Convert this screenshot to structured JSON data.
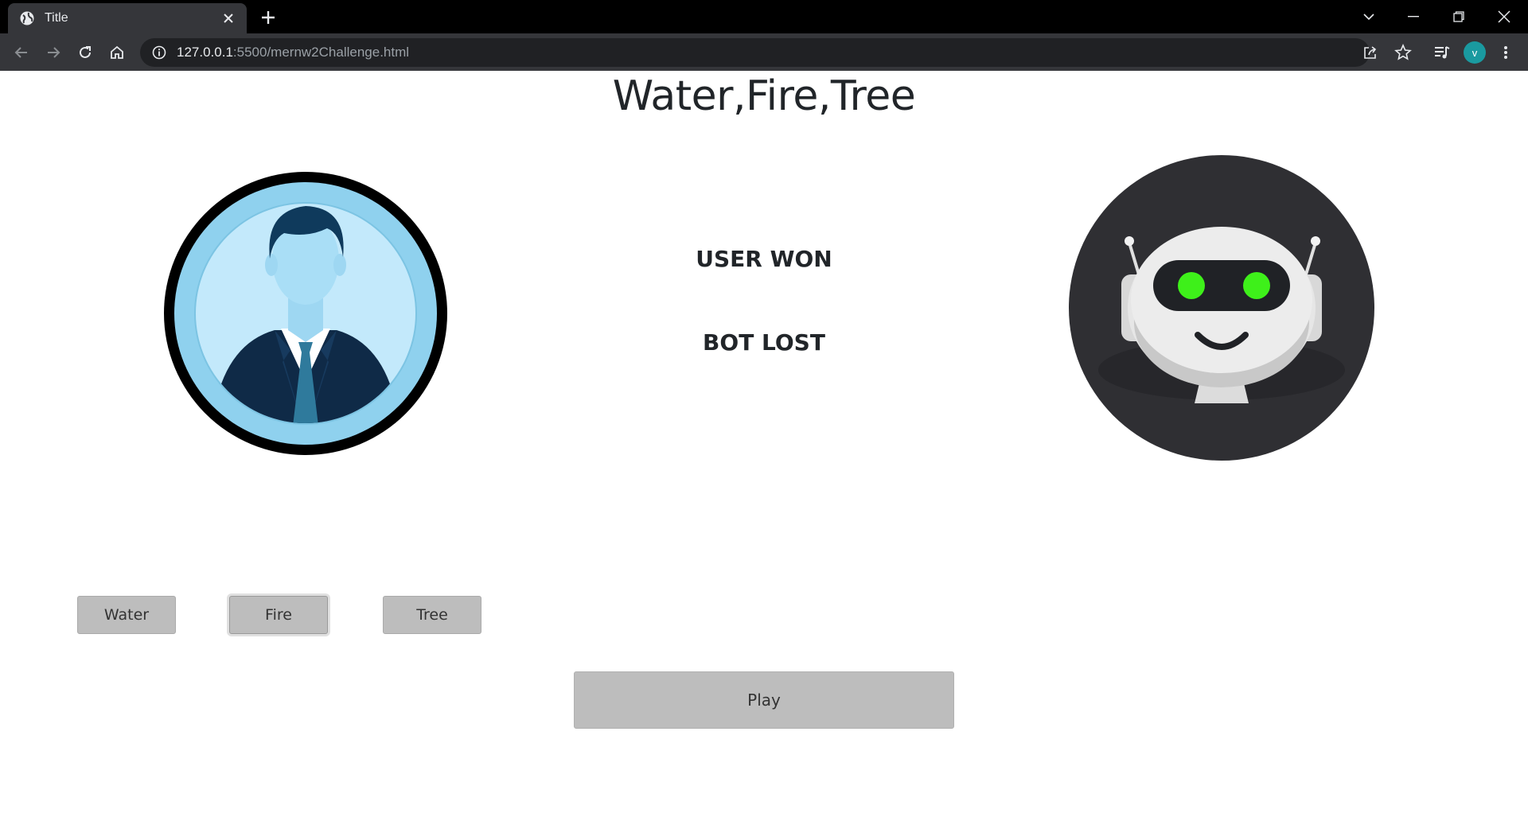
{
  "browser": {
    "tab_title": "Title",
    "url_host": "127.0.0.1",
    "url_rest": ":5500/mernw2Challenge.html",
    "profile_initial": "v",
    "profile_color": "#1a9aa0"
  },
  "game": {
    "title": "Water,Fire,Tree",
    "user_result": "USER WON",
    "bot_result": "BOT LOST",
    "choices": [
      "Water",
      "Fire",
      "Tree"
    ],
    "focused_choice": "Fire",
    "play_label": "Play"
  },
  "icons": {
    "user_avatar": "businessman-avatar-icon",
    "bot_avatar": "robot-avatar-icon"
  }
}
